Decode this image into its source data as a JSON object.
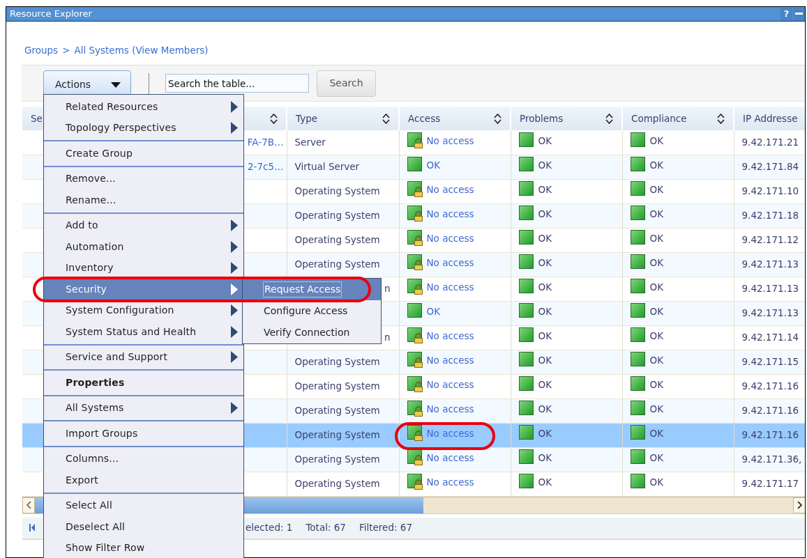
{
  "window": {
    "title": "Resource Explorer",
    "help": "?"
  },
  "breadcrumb": {
    "items": [
      "Groups",
      "All Systems (View Members)"
    ],
    "separator": ">"
  },
  "toolbar": {
    "actions_label": "Actions",
    "search": {
      "placeholder": "Search the table..."
    },
    "search_button": {
      "label": "Search",
      "disabled": true
    }
  },
  "table": {
    "columns": [
      {
        "label": "Se"
      },
      {
        "sort_icon": true
      },
      {
        "label": "Type",
        "sort_icon": true
      },
      {
        "label": "Access",
        "sort_icon": true
      },
      {
        "label": "Problems",
        "sort_icon": true
      },
      {
        "label": "Compliance",
        "sort_icon": true
      },
      {
        "label": "IP Addresse"
      }
    ],
    "rows": [
      {
        "name": "FA-7B…",
        "type": "Server",
        "type_cut": false,
        "access": "No access",
        "access_locked": true,
        "problems": "OK",
        "compliance": "OK",
        "ip": "9.42.171.21",
        "selected": false
      },
      {
        "name": "2-7c5…",
        "type": "Virtual Server",
        "type_cut": false,
        "access": "OK",
        "access_locked": false,
        "problems": "OK",
        "compliance": "OK",
        "ip": "9.42.171.84",
        "selected": false
      },
      {
        "type": "Operating System",
        "type_cut": false,
        "access": "No access",
        "access_locked": true,
        "problems": "OK",
        "compliance": "OK",
        "ip": "9.42.171.10",
        "selected": false
      },
      {
        "type": "Operating System",
        "type_cut": false,
        "access": "No access",
        "access_locked": true,
        "problems": "OK",
        "compliance": "OK",
        "ip": "9.42.171.18",
        "selected": false
      },
      {
        "type": "Operating System",
        "type_cut": false,
        "access": "No access",
        "access_locked": true,
        "problems": "OK",
        "compliance": "OK",
        "ip": "9.42.171.12",
        "selected": false
      },
      {
        "type": "Operating System",
        "type_cut": false,
        "access": "No access",
        "access_locked": true,
        "problems": "OK",
        "compliance": "OK",
        "ip": "9.42.171.13",
        "selected": false
      },
      {
        "type": "n",
        "type_cut": true,
        "access": "No access",
        "access_locked": true,
        "problems": "OK",
        "compliance": "OK",
        "ip": "9.42.171.13",
        "selected": false
      },
      {
        "access": "OK",
        "access_locked": false,
        "problems": "OK",
        "compliance": "OK",
        "ip": "9.42.171.13",
        "selected": false
      },
      {
        "type": "n",
        "type_cut": true,
        "access": "No access",
        "access_locked": true,
        "problems": "OK",
        "compliance": "OK",
        "ip": "9.42.171.14",
        "selected": false
      },
      {
        "type": "Operating System",
        "type_cut": false,
        "access": "No access",
        "access_locked": true,
        "problems": "OK",
        "compliance": "OK",
        "ip": "9.42.171.15",
        "selected": false
      },
      {
        "type": "Operating System",
        "type_cut": false,
        "access": "No access",
        "access_locked": true,
        "problems": "OK",
        "compliance": "OK",
        "ip": "9.42.171.16",
        "selected": false
      },
      {
        "type": "Operating System",
        "type_cut": false,
        "access": "No access",
        "access_locked": true,
        "problems": "OK",
        "compliance": "OK",
        "ip": "9.42.171.16",
        "selected": false
      },
      {
        "type": "Operating System",
        "type_cut": false,
        "access": "No access",
        "access_locked": true,
        "access_circled": true,
        "problems": "OK",
        "compliance": "OK",
        "ip": "9.42.171.16",
        "selected": true
      },
      {
        "type": "Operating System",
        "type_cut": false,
        "access": "No access",
        "access_locked": true,
        "problems": "OK",
        "compliance": "OK",
        "ip": "9.42.171.36,",
        "selected": false
      },
      {
        "type": "Operating System",
        "type_cut": false,
        "access": "No access",
        "access_locked": true,
        "problems": "OK",
        "compliance": "OK",
        "ip": "9.42.171.17",
        "selected": false
      }
    ]
  },
  "footer": {
    "selected": "elected: 1",
    "total": "Total: 67",
    "filtered": "Filtered: 67"
  },
  "menu": {
    "groups": [
      {
        "items": [
          {
            "label": "Related Resources",
            "submenu": true,
            "bold": false,
            "selected": false
          },
          {
            "label": "Topology Perspectives",
            "submenu": true,
            "bold": false,
            "selected": false
          }
        ]
      },
      {
        "items": [
          {
            "label": "Create Group",
            "submenu": false,
            "bold": false,
            "selected": false
          }
        ]
      },
      {
        "items": [
          {
            "label": "Remove...",
            "submenu": false,
            "bold": false,
            "selected": false
          },
          {
            "label": "Rename...",
            "submenu": false,
            "bold": false,
            "selected": false
          }
        ]
      },
      {
        "items": [
          {
            "label": "Add to",
            "submenu": true,
            "bold": false,
            "selected": false
          },
          {
            "label": "Automation",
            "submenu": true,
            "bold": false,
            "selected": false
          },
          {
            "label": "Inventory",
            "submenu": true,
            "bold": false,
            "selected": false
          },
          {
            "label": "Security",
            "submenu": true,
            "bold": false,
            "selected": true,
            "circled": true
          },
          {
            "label": "System Configuration",
            "submenu": true,
            "bold": false,
            "selected": false
          },
          {
            "label": "System Status and Health",
            "submenu": true,
            "bold": false,
            "selected": false
          }
        ]
      },
      {
        "items": [
          {
            "label": "Service and Support",
            "submenu": true,
            "bold": false,
            "selected": false
          }
        ]
      },
      {
        "items": [
          {
            "label": "Properties",
            "submenu": false,
            "bold": true,
            "selected": false
          }
        ]
      },
      {
        "items": [
          {
            "label": "All Systems",
            "submenu": true,
            "bold": false,
            "selected": false
          }
        ]
      },
      {
        "items": [
          {
            "label": "Import Groups",
            "submenu": false,
            "bold": false,
            "selected": false
          }
        ]
      },
      {
        "items": [
          {
            "label": "Columns...",
            "submenu": false,
            "bold": false,
            "selected": false
          },
          {
            "label": "Export",
            "submenu": false,
            "bold": false,
            "selected": false
          }
        ]
      },
      {
        "items": [
          {
            "label": "Select All",
            "submenu": false,
            "bold": false,
            "selected": false
          },
          {
            "label": "Deselect All",
            "submenu": false,
            "bold": false,
            "selected": false
          },
          {
            "label": "Show Filter Row",
            "submenu": false,
            "bold": false,
            "selected": false
          }
        ]
      }
    ]
  },
  "submenu": {
    "items": [
      {
        "label": "Request Access",
        "selected": true
      },
      {
        "label": "Configure Access",
        "selected": false
      },
      {
        "label": "Verify Connection",
        "selected": false
      }
    ]
  }
}
